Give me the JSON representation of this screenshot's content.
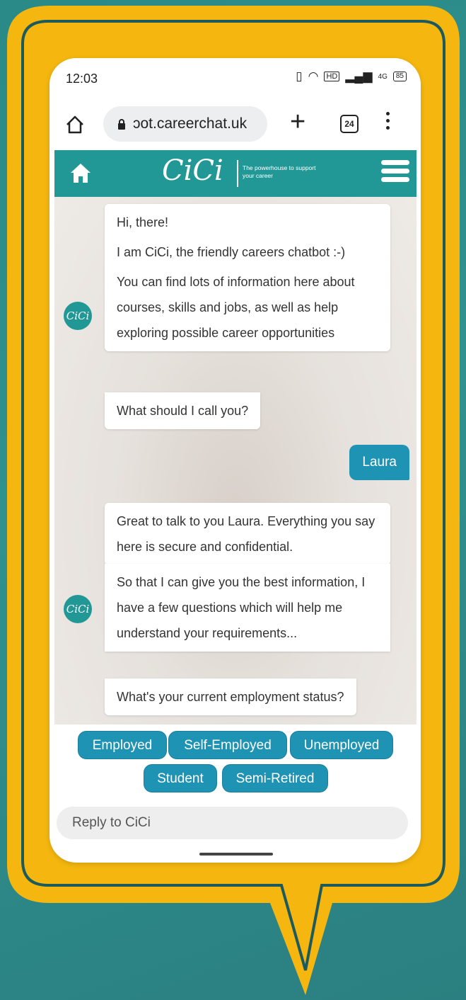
{
  "status_bar": {
    "time": "12:03",
    "network": "4G",
    "battery": "85"
  },
  "browser": {
    "url": "ɔot.careerchat.uk",
    "tab_count": "24"
  },
  "app_header": {
    "logo": "CiCi",
    "tagline": "The powerhouse to support your career"
  },
  "conversation": {
    "bot_avatar_label": "CiCi",
    "group1": {
      "messages": [
        "Hi, there!",
        "I am CiCi, the friendly careers chatbot :-)",
        "You can find lots of information here about courses, skills and jobs, as well as help exploring possible career opportunities"
      ],
      "question": "What should I call you?"
    },
    "user_reply": "Laura",
    "group2": {
      "message1": "Great to talk to you Laura. Everything you say here is secure and confidential.",
      "message2": "So that I can give you the best information, I have a few questions which will help me understand your requirements...",
      "question": "What's your current employment status?"
    }
  },
  "choices": [
    "Employed",
    "Self-Employed",
    "Unemployed",
    "Student",
    "Semi-Retired"
  ],
  "reply_input": {
    "placeholder": "Reply to CiCi",
    "value": ""
  },
  "colors": {
    "teal_brand": "#229896",
    "chip_blue": "#1f93b3",
    "frame_yellow": "#f5b70f"
  }
}
